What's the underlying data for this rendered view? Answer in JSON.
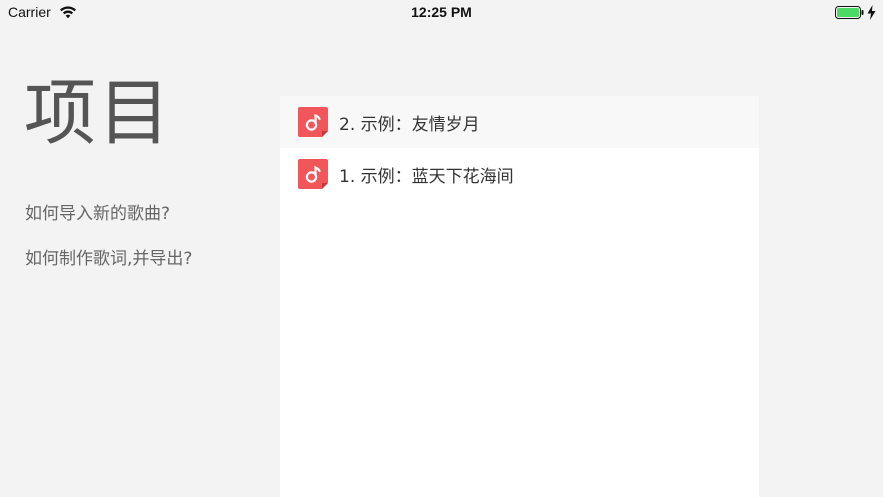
{
  "status_bar": {
    "carrier": "Carrier",
    "time": "12:25 PM",
    "battery_color": "#4cd964"
  },
  "sidebar": {
    "title": "项目",
    "help_links": [
      {
        "label": "如何导入新的歌曲?"
      },
      {
        "label": "如何制作歌词,并导出?"
      }
    ]
  },
  "projects": {
    "icon": "music-note-icon",
    "icon_color": "#f0565a",
    "items": [
      {
        "label": "2. 示例：友情岁月",
        "selected": true
      },
      {
        "label": "1. 示例：蓝天下花海间",
        "selected": false
      }
    ]
  }
}
